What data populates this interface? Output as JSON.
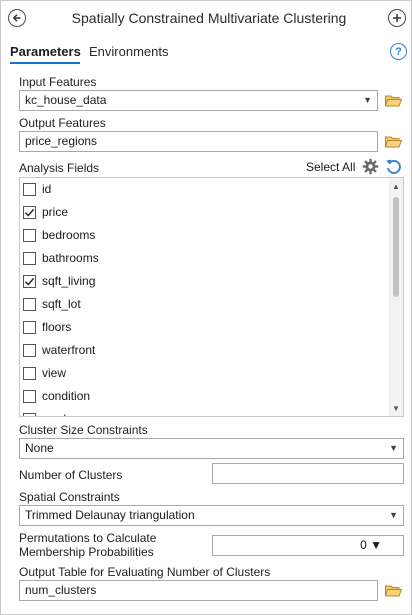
{
  "header": {
    "title": "Spatially Constrained Multivariate Clustering"
  },
  "tabs": {
    "parameters": "Parameters",
    "environments": "Environments"
  },
  "help": {
    "label": "?"
  },
  "input_features": {
    "label": "Input Features",
    "value": "kc_house_data"
  },
  "output_features": {
    "label": "Output Features",
    "value": "price_regions"
  },
  "analysis_fields": {
    "label": "Analysis Fields",
    "select_all": "Select All",
    "items": [
      {
        "label": "id",
        "checked": false
      },
      {
        "label": "price",
        "checked": true
      },
      {
        "label": "bedrooms",
        "checked": false
      },
      {
        "label": "bathrooms",
        "checked": false
      },
      {
        "label": "sqft_living",
        "checked": true
      },
      {
        "label": "sqft_lot",
        "checked": false
      },
      {
        "label": "floors",
        "checked": false
      },
      {
        "label": "waterfront",
        "checked": false
      },
      {
        "label": "view",
        "checked": false
      },
      {
        "label": "condition",
        "checked": false
      },
      {
        "label": "grade",
        "checked": false
      }
    ]
  },
  "cluster_size_constraints": {
    "label": "Cluster Size Constraints",
    "value": "None"
  },
  "number_of_clusters": {
    "label": "Number of Clusters",
    "value": ""
  },
  "spatial_constraints": {
    "label": "Spatial Constraints",
    "value": "Trimmed Delaunay triangulation"
  },
  "permutations": {
    "label_line1": "Permutations to Calculate",
    "label_line2": "Membership Probabilities",
    "value": "0"
  },
  "output_table": {
    "label": "Output Table for Evaluating Number of Clusters",
    "value": "num_clusters"
  },
  "colors": {
    "accent": "#1a73c9",
    "checkmark": "#2b2b2b",
    "folder": "#e8b84a",
    "refresh": "#2f7fd1"
  }
}
